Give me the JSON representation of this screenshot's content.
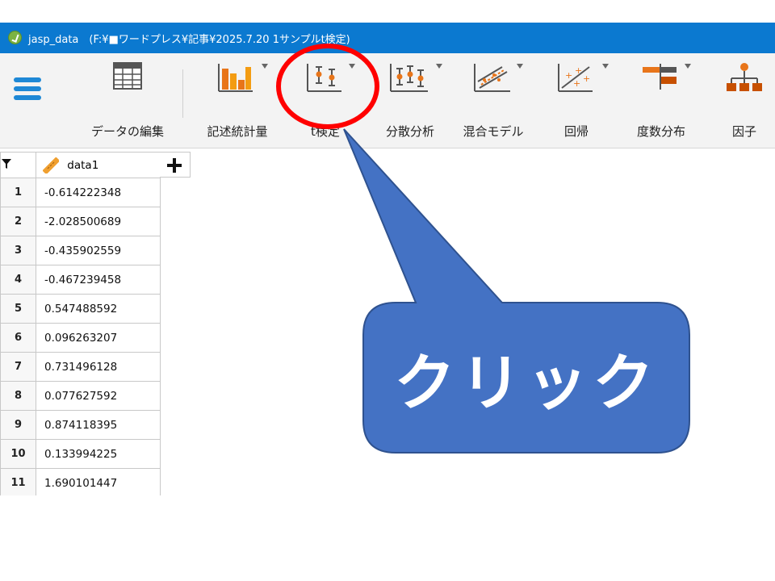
{
  "window": {
    "title": "jasp_data　(F:¥■ワードプレス¥記事¥2025.7.20 1サンプルt検定)",
    "app_icon": "jasp-logo-icon"
  },
  "toolbar": {
    "menu_icon": "hamburger-menu-icon",
    "items": [
      {
        "label": "データの編集",
        "icon": "spreadsheet-icon"
      },
      {
        "label": "記述統計量",
        "icon": "bar-chart-icon"
      },
      {
        "label": "t検定",
        "icon": "ttest-icon"
      },
      {
        "label": "分散分析",
        "icon": "anova-icon"
      },
      {
        "label": "混合モデル",
        "icon": "mixed-model-icon"
      },
      {
        "label": "回帰",
        "icon": "regression-icon"
      },
      {
        "label": "度数分布",
        "icon": "frequencies-icon"
      },
      {
        "label": "因子",
        "icon": "factor-icon"
      }
    ]
  },
  "grid": {
    "column_header": "data1",
    "filter_icon": "filter-icon",
    "column_type_icon": "ruler-scale-icon",
    "add_column_icon": "plus-icon",
    "rows": [
      {
        "n": "1",
        "value": "-0.614222348"
      },
      {
        "n": "2",
        "value": "-2.028500689"
      },
      {
        "n": "3",
        "value": "-0.435902559"
      },
      {
        "n": "4",
        "value": "-0.467239458"
      },
      {
        "n": "5",
        "value": "0.547488592"
      },
      {
        "n": "6",
        "value": "0.096263207"
      },
      {
        "n": "7",
        "value": "0.731496128"
      },
      {
        "n": "8",
        "value": "0.077627592"
      },
      {
        "n": "9",
        "value": "0.874118395"
      },
      {
        "n": "10",
        "value": "0.133994225"
      },
      {
        "n": "11",
        "value": "1.690101447"
      }
    ]
  },
  "annotation": {
    "callout_text": "クリック",
    "callout_color": "#4472c4",
    "circle_color": "#ff0000"
  }
}
